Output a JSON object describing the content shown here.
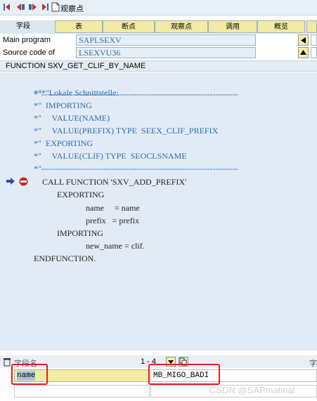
{
  "toolbar": {
    "icons": [
      "first-page-icon",
      "prev-page-icon",
      "next-page-icon",
      "last-page-icon",
      "document-icon"
    ],
    "watchpoint_label": "观察点"
  },
  "tabs": [
    "字段",
    "表",
    "断点",
    "观察点",
    "调用",
    "概览"
  ],
  "info": {
    "main_program_label": "Main program",
    "main_program_value": "SAPLSEXV",
    "source_label": "Source code of",
    "source_value": "LSEXVU36"
  },
  "function_header": "FUNCTION SXV_GET_CLIF_BY_NAME",
  "code": {
    "lines": [
      "*\"----------------------------------------------------------------------",
      "*\"*\"Lokale Schnittstelle:",
      "*\"  IMPORTING",
      "*\"     VALUE(NAME)",
      "*\"     VALUE(PREFIX) TYPE  SEEX_CLIF_PREFIX",
      "*\"  EXPORTING",
      "*\"     VALUE(CLIF) TYPE  SEOCLSNAME",
      "*\"----------------------------------------------------------------------",
      "CALL FUNCTION 'SXV_ADD_PREFIX'",
      "     EXPORTING",
      "          name     = name",
      "          prefix   = prefix",
      "     IMPORTING",
      "          new_name = clif.",
      "ENDFUNCTION."
    ]
  },
  "bottom": {
    "field_name_header": "字段名",
    "pager": "1 - 4",
    "right_header": "字",
    "row_name": "name",
    "row_value": "MB_MIGO_BADI"
  },
  "watermark": "CSDN @SAPmatinal",
  "colors": {
    "tab_bg": "#f3eba4",
    "code_bg": "#e2ebf5",
    "comment": "#2e6bb0",
    "highlight_red": "#e02020"
  }
}
